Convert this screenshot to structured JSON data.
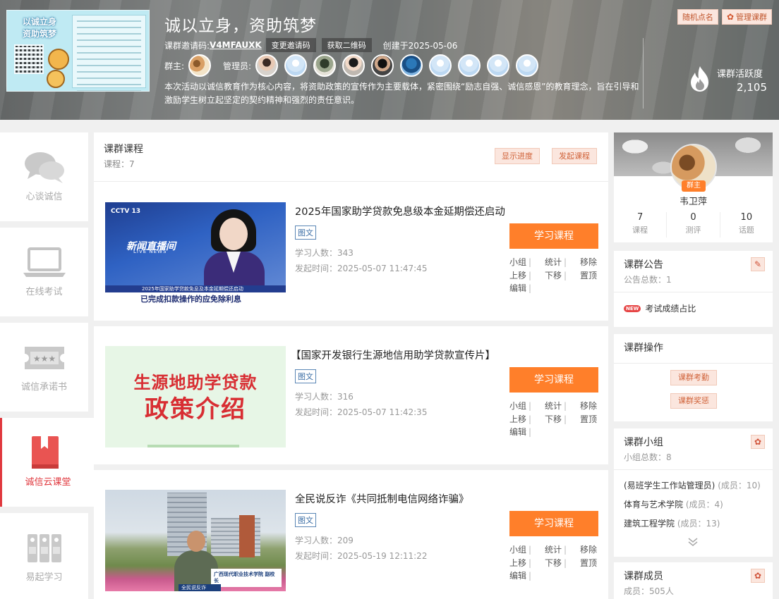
{
  "header": {
    "title": "诚以立身，资助筑梦",
    "invite_label": "课群邀请码:",
    "invite_code": "V4MFAUXK",
    "change_code": "变更邀请码",
    "get_qr": "获取二维码",
    "created": "创建于2025-05-06",
    "owner_label": "群主:",
    "admins_label": "管理员:",
    "description": "本次活动以诚信教育作为核心内容，将资助政策的宣传作为主要载体，紧密围绕“励志自强、诚信感恩”的教育理念，旨在引导和激励学生树立起坚定的契约精神和强烈的责任意识。",
    "random_call": "随机点名",
    "manage_group": "管理课群",
    "activity_label": "课群活跃度",
    "activity_value": "2,105",
    "poster_title": "以诚立身\n资助筑梦"
  },
  "sidebar": {
    "items": [
      {
        "label": "心谈诚信",
        "icon": "chat-bubbles-icon"
      },
      {
        "label": "在线考试",
        "icon": "laptop-icon"
      },
      {
        "label": "诚信承诺书",
        "icon": "ticket-icon"
      },
      {
        "label": "诚信云课堂",
        "icon": "bookmark-book-icon"
      },
      {
        "label": "易起学习",
        "icon": "binders-icon"
      }
    ]
  },
  "courses": {
    "title": "课群课程",
    "count_text": "课程：7",
    "show_progress": "显示进度",
    "launch": "发起课程",
    "learn_label": "学习课程",
    "ops": {
      "group": "小组",
      "stats": "统计",
      "remove": "移除",
      "up": "上移",
      "down": "下移",
      "top": "置顶",
      "edit": "编辑"
    },
    "items": [
      {
        "title": "2025年国家助学贷款免息级本金延期偿还启动",
        "tag": "图文",
        "learners": "学习人数：343",
        "time": "发起时间：2025-05-07 11:47:45",
        "thumb": {
          "channel": "CCTV 13",
          "live_cn": "新闻直播间",
          "live_en": "LIVE NEWS",
          "strap_top": "2025年国家助学贷款免息及本金延期偿还启动",
          "strap": "已完成扣款操作的应免除利息"
        }
      },
      {
        "title": "【国家开发银行生源地信用助学贷款宣传片】",
        "tag": "图文",
        "learners": "学习人数：316",
        "time": "发起时间：2025-05-07 11:42:35",
        "thumb": {
          "line1": "生源地助学贷款",
          "line2": "政策介绍"
        }
      },
      {
        "title": "全民说反诈《共同抵制电信网络诈骗》",
        "tag": "图文",
        "learners": "学习人数：209",
        "time": "发起时间：2025-05-19 12:11:22",
        "thumb": {
          "caption": "广西现代职业技术学院 副校长",
          "label": "全民说反诈"
        }
      }
    ]
  },
  "owner": {
    "badge": "群主",
    "name": "韦卫萍",
    "stats": [
      {
        "n": "7",
        "l": "课程"
      },
      {
        "n": "0",
        "l": "测评"
      },
      {
        "n": "10",
        "l": "话题"
      }
    ]
  },
  "notice": {
    "title": "课群公告",
    "total": "公告总数：1",
    "new_badge": "NEW",
    "item": "考试成绩占比"
  },
  "ops_panel": {
    "title": "课群操作",
    "attendance": "课群考勤",
    "reward": "课群奖惩"
  },
  "groups": {
    "title": "课群小组",
    "total": "小组总数：8",
    "items": [
      {
        "name": "(易班学生工作站管理员)",
        "members": "(成员：10)"
      },
      {
        "name": "体育与艺术学院",
        "members": "(成员：4)"
      },
      {
        "name": "建筑工程学院",
        "members": "(成员：13)"
      }
    ]
  },
  "members": {
    "title": "课群成员",
    "total": "成员：505人"
  },
  "colors": {
    "accent": "#ff7f2a",
    "active": "#e0383e"
  }
}
